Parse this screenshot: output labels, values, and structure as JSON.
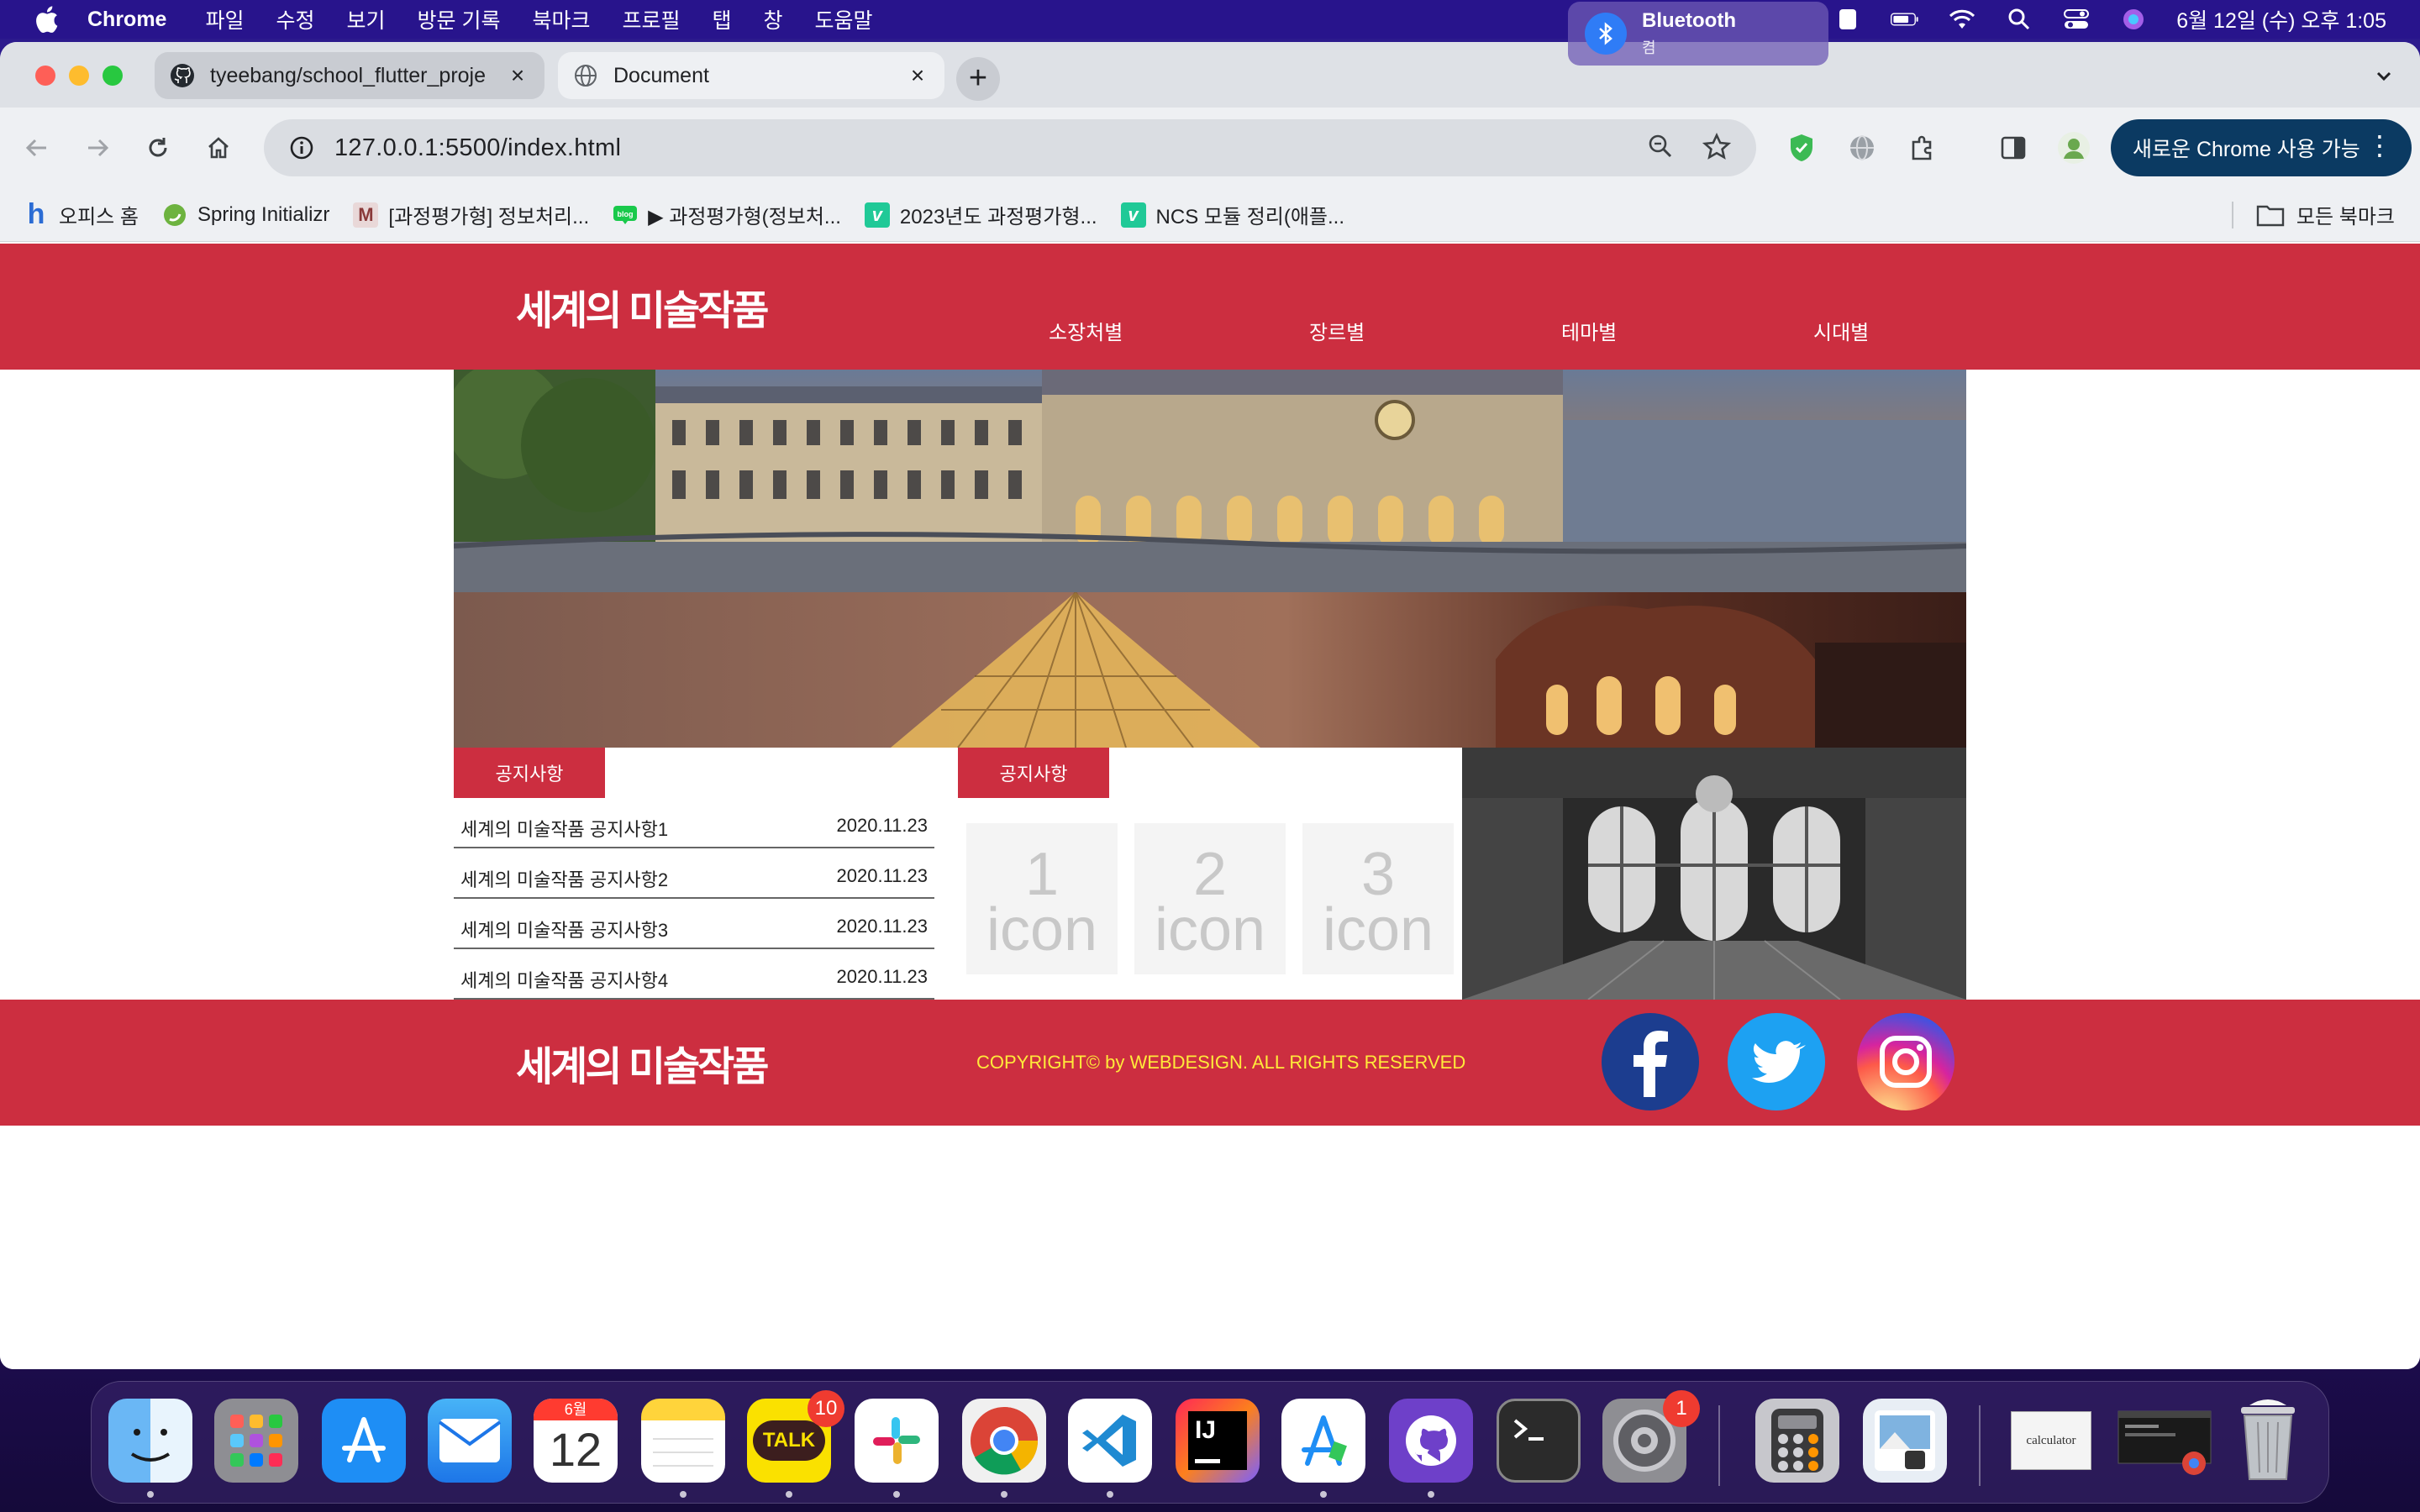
{
  "menubar": {
    "app_name": "Chrome",
    "items": [
      "파일",
      "수정",
      "보기",
      "방문 기록",
      "북마크",
      "프로필",
      "탭",
      "창",
      "도움말"
    ],
    "clock": "6월 12일 (수) 오후 1:05"
  },
  "bluetooth_popup": {
    "title": "Bluetooth",
    "subtitle": "켬"
  },
  "browser": {
    "tabs": [
      {
        "title": "tyeebang/school_flutter_proje",
        "icon": "github-icon",
        "active": false
      },
      {
        "title": "Document",
        "icon": "globe-icon",
        "active": true
      }
    ],
    "new_tab_label": "+",
    "url": "127.0.0.1:5500/index.html",
    "update_button": "새로운 Chrome 사용 가능",
    "bookmarks": [
      {
        "label": "오피스 홈",
        "icon": "h"
      },
      {
        "label": "Spring Initializr",
        "icon": "spring-icon"
      },
      {
        "label": "[과정평가형] 정보처리...",
        "icon": "M"
      },
      {
        "label": "▶ 과정평가형(정보처...",
        "icon": "naver-blog-icon"
      },
      {
        "label": "2023년도 과정평가형...",
        "icon": "v"
      },
      {
        "label": "NCS 모듈 정리(애플...",
        "icon": "v"
      }
    ],
    "all_bookmarks": "모든 북마크"
  },
  "site": {
    "logo": "세계의 미술작품",
    "nav": [
      "소장처별",
      "장르별",
      "테마별",
      "시대별"
    ],
    "notice_tab": "공지사항",
    "notices": [
      {
        "title": "세계의 미술작품 공지사항1",
        "date": "2020.11.23"
      },
      {
        "title": "세계의 미술작품 공지사항2",
        "date": "2020.11.23"
      },
      {
        "title": "세계의 미술작품 공지사항3",
        "date": "2020.11.23"
      },
      {
        "title": "세계의 미술작품 공지사항4",
        "date": "2020.11.23"
      }
    ],
    "icon_tab": "공지사항",
    "icons": [
      {
        "num": "1",
        "word": "icon"
      },
      {
        "num": "2",
        "word": "icon"
      },
      {
        "num": "3",
        "word": "icon"
      }
    ],
    "footer_logo": "세계의 미술작품",
    "copyright": "COPYRIGHT© by WEBDESIGN. ALL RIGHTS RESERVED",
    "social": [
      "facebook-icon",
      "twitter-icon",
      "instagram-icon"
    ]
  },
  "dock": {
    "apps": [
      "Finder",
      "Launchpad",
      "App Store",
      "Mail",
      "Calendar",
      "Notes",
      "KakaoTalk",
      "Slack",
      "Chrome",
      "VS Code",
      "IntelliJ IDEA",
      "Instruments",
      "GitHub Desktop",
      "Terminal",
      "System Settings",
      "Calculator",
      "Preview"
    ],
    "calendar_month": "6월",
    "calendar_day": "12",
    "kakao_label": "TALK",
    "kakao_badge": "10",
    "settings_badge": "1",
    "calculator_window_label": "calculator"
  },
  "colors": {
    "accent_red": "#cc2e40",
    "copyright_yellow": "#ffea3a",
    "chrome_update_blue": "#0b3a62"
  }
}
